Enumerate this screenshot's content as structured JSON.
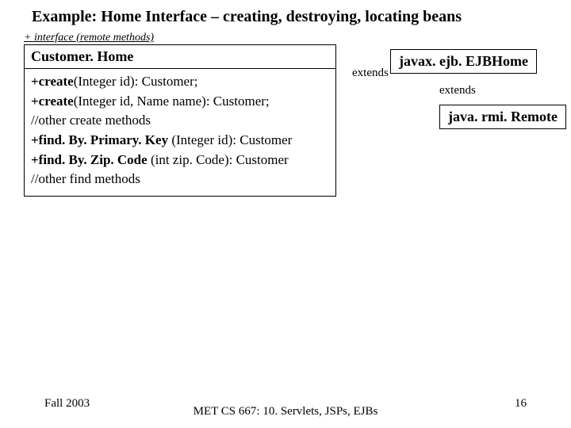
{
  "title": "Example: Home Interface – creating, destroying, locating beans",
  "stereotype": "+ interface (remote methods)",
  "class_box": {
    "name": "Customer. Home",
    "methods": [
      {
        "bold": "+create",
        "rest": "(Integer id): Customer;"
      },
      {
        "bold": "+create",
        "rest": "(Integer id, Name name): Customer;"
      },
      {
        "bold": "",
        "rest": "//other create methods"
      },
      {
        "bold": "+find. By. Primary. Key",
        "rest": " (Integer id): Customer"
      },
      {
        "bold": "+find. By. Zip. Code",
        "rest": " (int zip. Code): Customer"
      },
      {
        "bold": "",
        "rest": "//other find methods"
      }
    ]
  },
  "extends1": "extends",
  "ejbhome": "javax. ejb. EJBHome",
  "extends2": "extends",
  "remote": "java. rmi. Remote",
  "footer": {
    "left": "Fall 2003",
    "center": "MET CS 667: 10. Servlets, JSPs, EJBs",
    "right": "16"
  }
}
